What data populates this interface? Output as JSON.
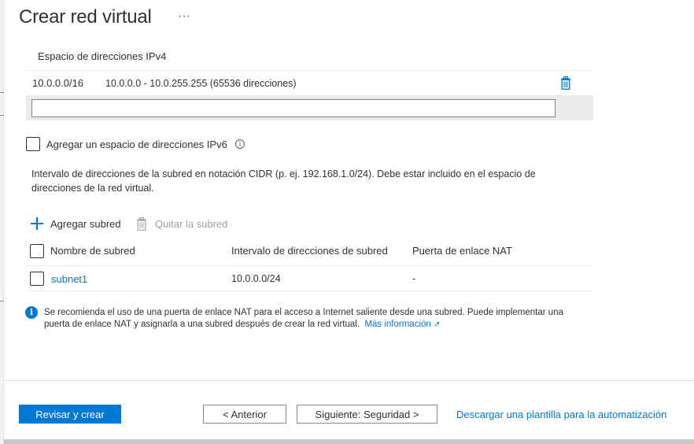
{
  "header": {
    "title": "Crear red virtual",
    "more_label": "···"
  },
  "ipv4": {
    "header": "Espacio de direcciones IPv4",
    "rows": [
      {
        "cidr": "10.0.0.0/16",
        "range": "10.0.0.0 - 10.0.255.255 (65536 direcciones)"
      }
    ],
    "input_value": ""
  },
  "ipv6": {
    "label": "Agregar un espacio de direcciones IPv6",
    "info_glyph": "i",
    "checked": false
  },
  "subnet_description": "Intervalo de direcciones de la subred en notación CIDR (p. ej. 192.168.1.0/24). Debe estar incluido en el espacio de direcciones de la red virtual.",
  "toolbar": {
    "add_subnet": "Agregar subred",
    "remove_subnet": "Quitar la subred"
  },
  "subnet_table": {
    "columns": [
      "Nombre de subred",
      "Intervalo de direcciones de subred",
      "Puerta de enlace NAT"
    ],
    "rows": [
      {
        "name": "subnet1",
        "range": "10.0.0.0/24",
        "nat": "-"
      }
    ]
  },
  "info_banner": {
    "glyph": "i",
    "text": "Se recomienda el uso de una puerta de enlace NAT para el acceso a Internet saliente desde una subred. Puede implementar una puerta de enlace NAT y asignarla a una subred después de crear la red virtual.",
    "link": "Más información",
    "link_icon": "↗"
  },
  "footer": {
    "review_create": "Revisar y crear",
    "previous": "< Anterior",
    "next": "Siguiente: Seguridad >",
    "download_template": "Descargar una plantilla para la automatización"
  },
  "colors": {
    "accent": "#0078d4",
    "text": "#323130",
    "disabled": "#a19f9d",
    "row_band": "#edebe9"
  }
}
